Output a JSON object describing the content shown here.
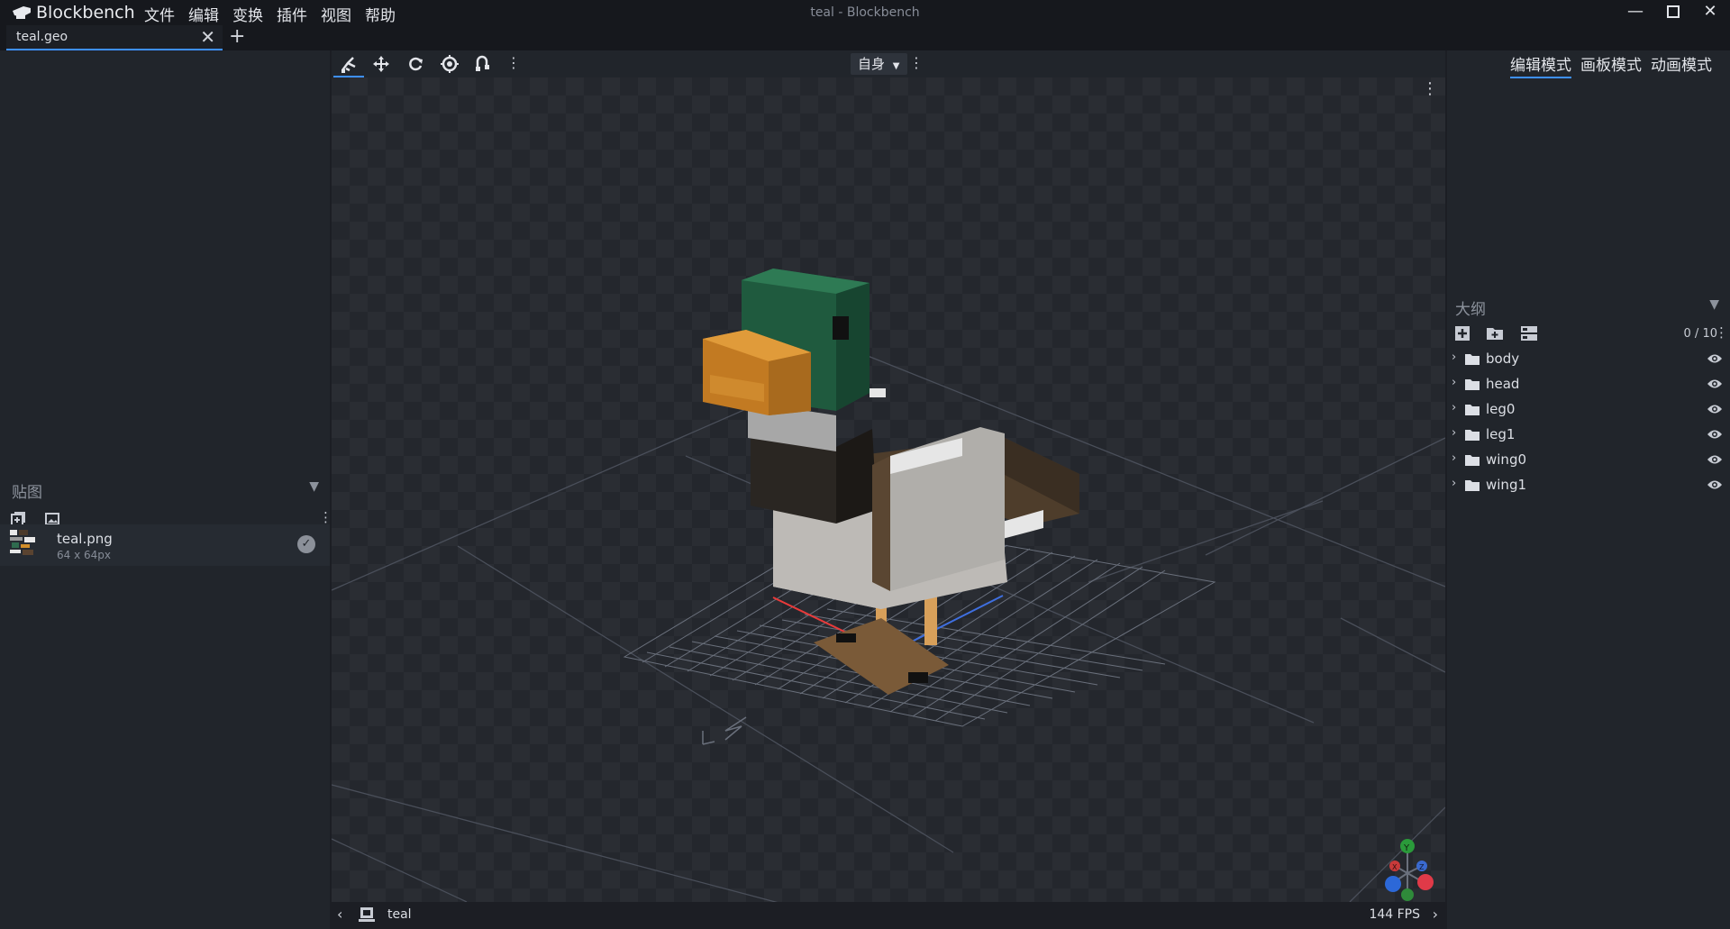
{
  "app": {
    "name": "Blockbench",
    "window_title": "teal - Blockbench"
  },
  "menu": [
    "文件",
    "编辑",
    "变换",
    "插件",
    "视图",
    "帮助"
  ],
  "tab": {
    "label": "teal.geo"
  },
  "toolbar": {
    "space_mode": "自身"
  },
  "modes": {
    "edit": "编辑模式",
    "paint": "画板模式",
    "animate": "动画模式"
  },
  "textures": {
    "title": "贴图",
    "items": [
      {
        "name": "teal.png",
        "size": "64 x 64px"
      }
    ]
  },
  "outliner": {
    "title": "大纲",
    "count": "0 / 10",
    "groups": [
      {
        "name": "body"
      },
      {
        "name": "head"
      },
      {
        "name": "leg0"
      },
      {
        "name": "leg1"
      },
      {
        "name": "wing0"
      },
      {
        "name": "wing1"
      }
    ]
  },
  "viewport": {
    "model_name": "teal",
    "fps": "144 FPS"
  },
  "colors": {
    "accent": "#3e90ff",
    "panel": "#21252b",
    "bg": "#1c1e24"
  }
}
